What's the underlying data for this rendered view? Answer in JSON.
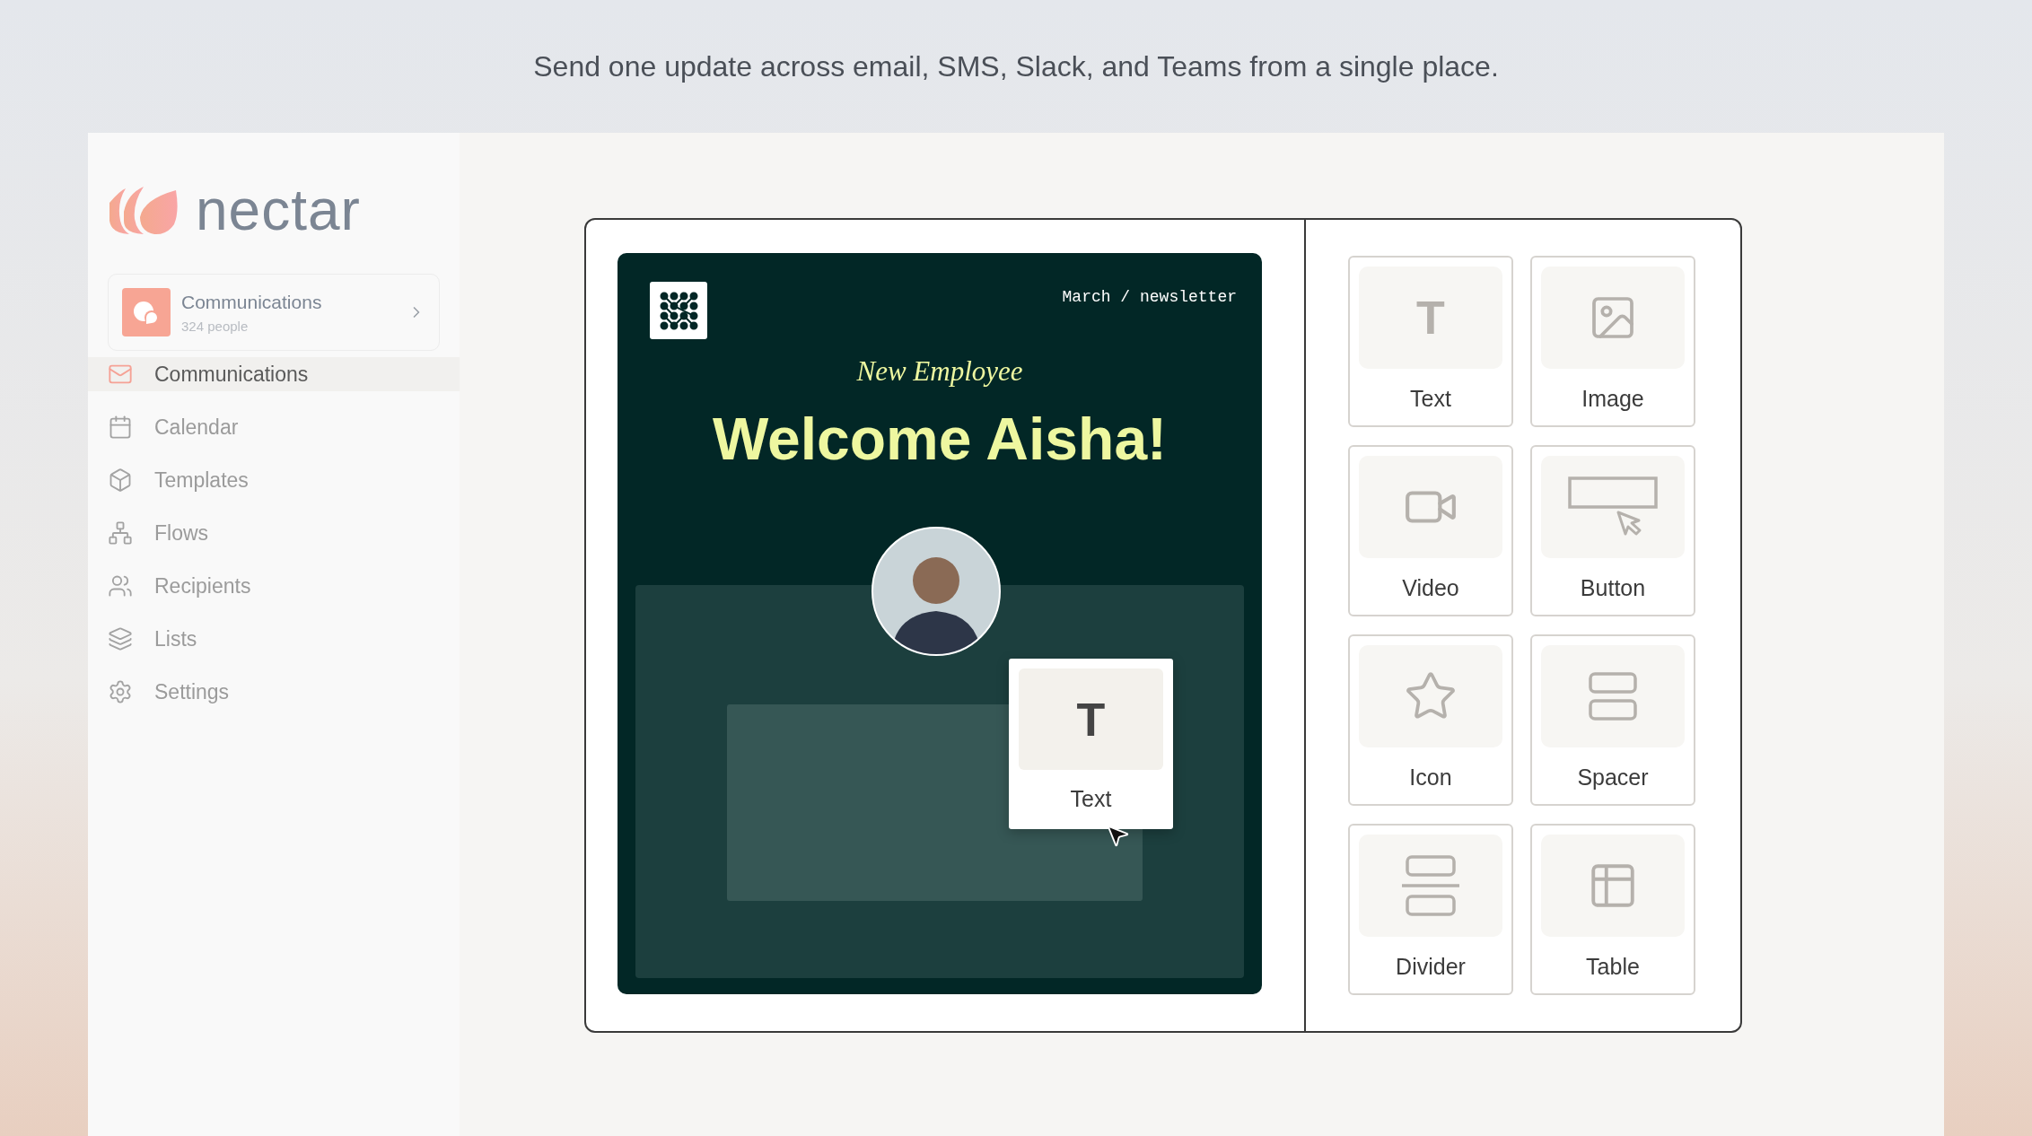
{
  "tagline": "Send one update across email, SMS, Slack, and Teams from a single place.",
  "sidebar": {
    "logo_text": "nectar",
    "workspace": {
      "name": "Communications",
      "count": "324 people"
    },
    "items": [
      {
        "label": "Communications",
        "selected": true
      },
      {
        "label": "Calendar",
        "selected": false
      },
      {
        "label": "Templates",
        "selected": false
      },
      {
        "label": "Flows",
        "selected": false
      },
      {
        "label": "Recipients",
        "selected": false
      },
      {
        "label": "Lists",
        "selected": false
      },
      {
        "label": "Settings",
        "selected": false
      }
    ]
  },
  "email": {
    "meta": "March / newsletter",
    "eyebrow": "New Employee",
    "headline": "Welcome Aisha!"
  },
  "drag_block": {
    "glyph": "T",
    "label": "Text"
  },
  "blocks": [
    {
      "kind": "text",
      "glyph": "T",
      "label": "Text"
    },
    {
      "kind": "image",
      "label": "Image"
    },
    {
      "kind": "video",
      "label": "Video"
    },
    {
      "kind": "button",
      "label": "Button"
    },
    {
      "kind": "icon",
      "label": "Icon"
    },
    {
      "kind": "spacer",
      "label": "Spacer"
    },
    {
      "kind": "divider",
      "label": "Divider"
    },
    {
      "kind": "table",
      "label": "Table"
    }
  ]
}
